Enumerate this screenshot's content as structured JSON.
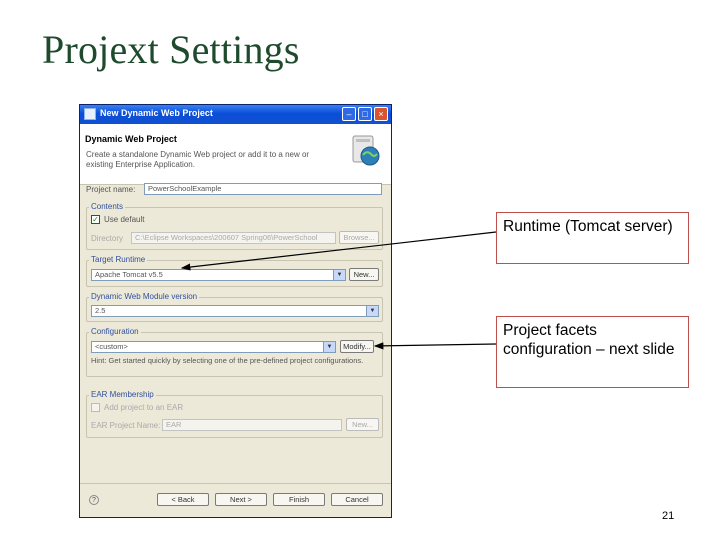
{
  "slide": {
    "title": "Projext Settings",
    "page_number": "21"
  },
  "dialog": {
    "window_title": "New Dynamic Web Project",
    "header_title": "Dynamic Web Project",
    "header_description": "Create a standalone Dynamic Web project or add it to a new or existing Enterprise Application.",
    "project_name_label": "Project name:",
    "project_name_value": "PowerSchoolExample",
    "contents": {
      "group_label": "Contents",
      "use_default_label": "Use default",
      "use_default_checked": true,
      "directory_label": "Directory",
      "directory_value": "C:\\Eclipse Workspaces\\200607 Spring06\\PowerSchool",
      "browse_label": "Browse..."
    },
    "target_runtime": {
      "group_label": "Target Runtime",
      "value": "Apache Tomcat v5.5",
      "new_label": "New..."
    },
    "module_version": {
      "group_label": "Dynamic Web Module version",
      "value": "2.5"
    },
    "configuration": {
      "group_label": "Configuration",
      "value": "<custom>",
      "modify_label": "Modify...",
      "hint": "Hint: Get started quickly by selecting one of the pre-defined project configurations."
    },
    "ear": {
      "group_label": "EAR Membership",
      "add_label": "Add project to an EAR",
      "project_name_label": "EAR Project Name:",
      "project_name_value": "EAR",
      "new_label": "New..."
    },
    "buttons": {
      "back": "< Back",
      "next": "Next >",
      "finish": "Finish",
      "cancel": "Cancel"
    },
    "icons": {
      "help": "help-icon",
      "header": "web-project-icon"
    }
  },
  "callouts": {
    "runtime": "Runtime (Tomcat server)",
    "facets": "Project facets configuration – next slide"
  },
  "colors": {
    "title": "#1f4a2e",
    "callout_border": "#c0504d",
    "titlebar": "#0a4ed8"
  }
}
